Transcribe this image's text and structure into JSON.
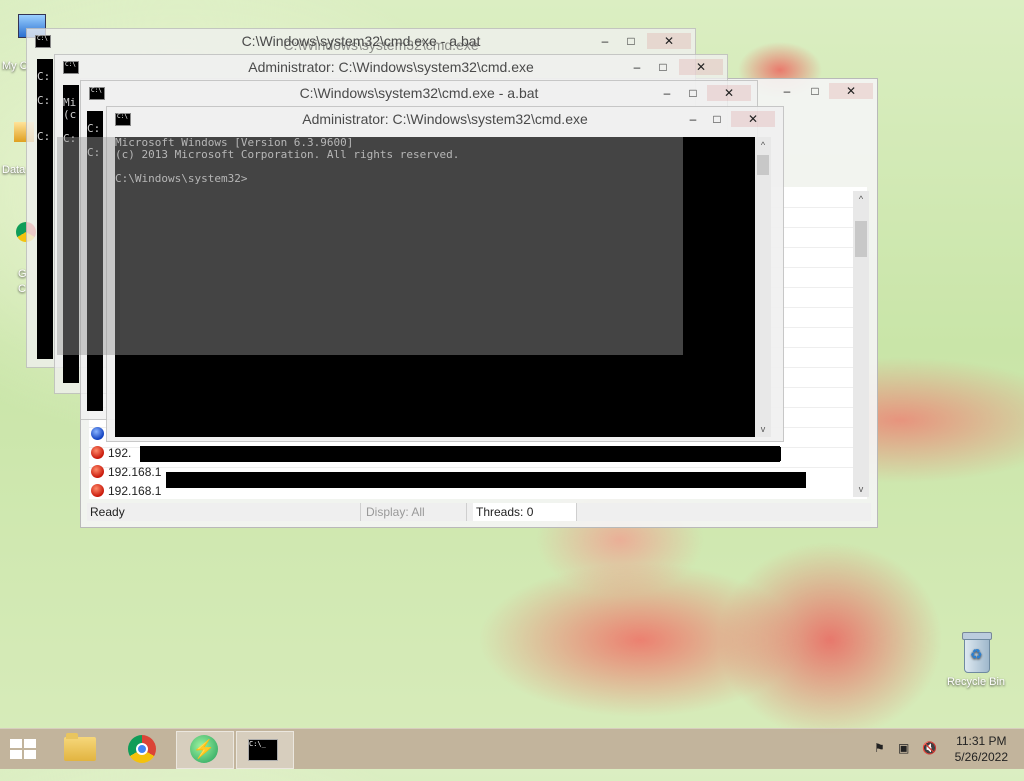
{
  "desktop": {
    "recycle_bin_label": "Recycle Bin",
    "partial_labels": [
      "My C",
      "Data",
      "G",
      "C"
    ]
  },
  "windows": [
    {
      "title": "C:\\Windows\\system32\\cmd.exe - a.bat",
      "overlay_title": "C:\\Windows\\system32\\cmd.exe",
      "console_prefix": [
        "C:",
        "C:",
        "C:"
      ]
    },
    {
      "title": "Administrator: C:\\Windows\\system32\\cmd.exe",
      "console_prefix": [
        "Mi",
        "(c",
        "C:"
      ]
    },
    {
      "title": "C:\\Windows\\system32\\cmd.exe - a.bat",
      "console_prefix": [
        "C:",
        "C:"
      ]
    },
    {
      "title": "Administrator: C:\\Windows\\system32\\cmd.exe",
      "console_lines": [
        "Microsoft Windows [Version 6.3.9600]",
        "(c) 2013 Microsoft Corporation. All rights reserved.",
        "",
        "C:\\Windows\\system32>"
      ]
    }
  ],
  "controls": {
    "minimize": "–",
    "maximize": "□",
    "close": "✕",
    "up": "^",
    "down": "v"
  },
  "list_window": {
    "rows": [
      "192.",
      "192.168.1",
      "192.168.1"
    ],
    "status": {
      "ready": "Ready",
      "display": "Display: All",
      "threads": "Threads: 0"
    }
  },
  "taskbar": {
    "clock_time": "11:31 PM",
    "clock_date": "5/26/2022"
  }
}
